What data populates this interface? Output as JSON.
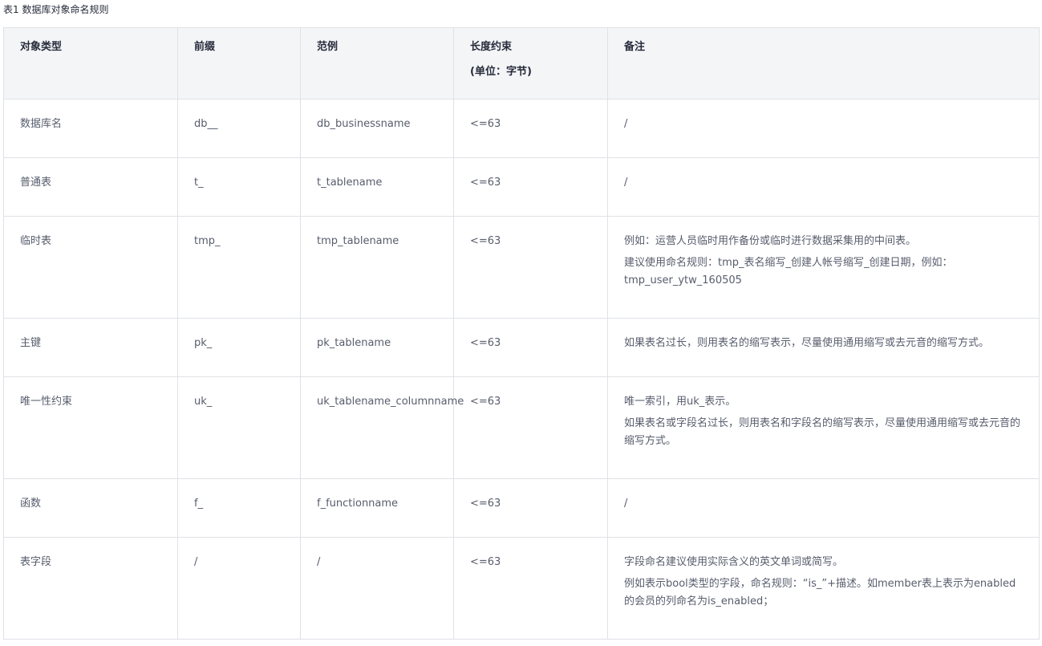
{
  "caption": "表1 数据库对象命名规则",
  "headers": {
    "type": "对象类型",
    "prefix": "前缀",
    "example": "范例",
    "length_line1": "长度约束",
    "length_line2": "(单位：字节)",
    "note": "备注"
  },
  "rows": [
    {
      "type": "数据库名",
      "prefix": "db__",
      "example": "db_businessname",
      "length": "<=63",
      "notes": [
        "/"
      ]
    },
    {
      "type": "普通表",
      "prefix": "t_",
      "example": "t_tablename",
      "length": "<=63",
      "notes": [
        "/"
      ]
    },
    {
      "type": "临时表",
      "prefix": "tmp_",
      "example": "tmp_tablename",
      "length": "<=63",
      "notes": [
        "例如：运营人员临时用作备份或临时进行数据采集用的中间表。",
        "建议使用命名规则：tmp_表名缩写_创建人帐号缩写_创建日期，例如：tmp_user_ytw_160505"
      ]
    },
    {
      "type": "主键",
      "prefix": "pk_",
      "example": "pk_tablename",
      "length": "<=63",
      "notes": [
        "如果表名过长，则用表名的缩写表示，尽量使用通用缩写或去元音的缩写方式。"
      ]
    },
    {
      "type": "唯一性约束",
      "prefix": "uk_",
      "example": "uk_tablename_columnname",
      "length": "<=63",
      "notes": [
        "唯一索引，用uk_表示。",
        "如果表名或字段名过长，则用表名和字段名的缩写表示，尽量使用通用缩写或去元音的缩写方式。"
      ]
    },
    {
      "type": "函数",
      "prefix": "f_",
      "example": "f_functionname",
      "length": "<=63",
      "notes": [
        "/"
      ]
    },
    {
      "type": "表字段",
      "prefix": "/",
      "example": "/",
      "length": "<=63",
      "notes": [
        "字段命名建议使用实际含义的英文单词或简写。",
        "例如表示bool类型的字段，命名规则：“is_”+描述。如member表上表示为enabled的会员的列命名为is_enabled；"
      ]
    }
  ]
}
